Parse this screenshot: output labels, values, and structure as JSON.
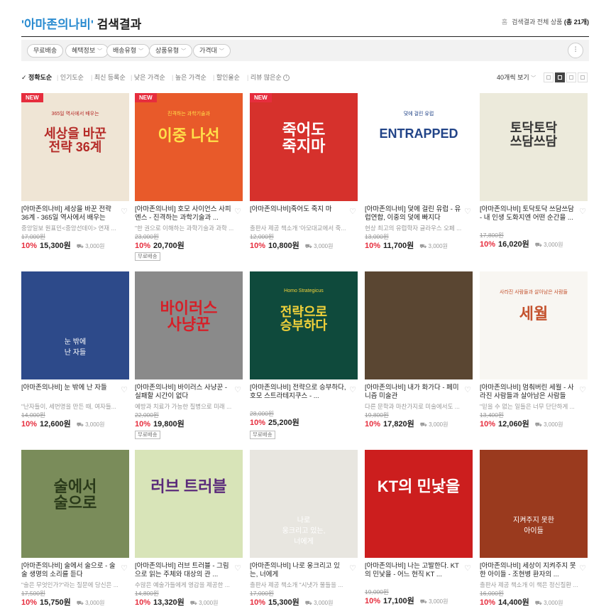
{
  "header": {
    "keyword": "'아마존의나비'",
    "suffix": "검색결과",
    "home": "홈",
    "crumb_pre": "검색결과 전체 상품",
    "crumb_count": "(총 21개)"
  },
  "filters": [
    "무료배송",
    "혜택정보",
    "배송유형",
    "상품유형",
    "가격대"
  ],
  "sorts": [
    "정확도순",
    "인기도순",
    "최신 등록순",
    "낮은 가격순",
    "높은 가격순",
    "할인율순",
    "리뷰 많은순"
  ],
  "view": {
    "per_page": "40개씩 보기"
  },
  "products": [
    {
      "title": "[아마존의나비] 세상을 바꾼 전략 36계 - 365일 역사에서 배우는",
      "desc": "중앙일보 원표민<중앙선데이> 연재 ...",
      "orig": "17,000원",
      "pct": "10%",
      "price": "15,300원",
      "ship": "3,000원",
      "new": true,
      "tag": "",
      "cover": {
        "bg": "#efe5d5",
        "title": "세상을 바꾼\n전략 36계",
        "sub": "365일 역사에서 배우는",
        "color": "#b52b28"
      }
    },
    {
      "title": "[아마존의나비] 호모 사이언스 사피엔스 - 진격하는 과학기술과 ...",
      "desc": "\"한 권으로 이해하는 과학기술과 과학 ...",
      "orig": "23,000원",
      "pct": "10%",
      "price": "20,700원",
      "ship": "",
      "new": true,
      "tag": "무료배송",
      "cover": {
        "bg": "#e85a2a",
        "title": "이중 나선",
        "sub": "진격하는 과학기술과",
        "color": "#ffe04a"
      }
    },
    {
      "title": "[아마존의나비]죽어도 죽지 마",
      "desc": "출판사 제공 책소개 '아모대교에서 죽...",
      "orig": "12,000원",
      "pct": "10%",
      "price": "10,800원",
      "ship": "3,000원",
      "new": true,
      "tag": "",
      "cover": {
        "bg": "#d6312c",
        "title": "죽어도\n죽지마",
        "sub": "",
        "color": "#ffffff"
      }
    },
    {
      "title": "[아마존의나비] 덫에 걸린 유럽 - 유럽연합, 이중의 덫에 빠지다",
      "desc": "현상 최고의 유럽학자 글라우스 오페 ...",
      "orig": "13,000원",
      "pct": "10%",
      "price": "11,700원",
      "ship": "3,000원",
      "new": false,
      "tag": "",
      "cover": {
        "bg": "#ffffff",
        "title": "ENTRAPPED",
        "sub": "덫에 걸린 유럽",
        "color": "#224488"
      }
    },
    {
      "title": "[아마존의나비] 토닥토닥 쓰담쓰담 - 내 인생 도화지엔 어떤 순간을 ...",
      "desc": "",
      "orig": "17,800원",
      "pct": "10%",
      "price": "16,020원",
      "ship": "3,000원",
      "new": false,
      "tag": "",
      "cover": {
        "bg": "#eceadb",
        "title": "토닥토닥\n쓰담쓰담",
        "sub": "",
        "color": "#333333"
      }
    },
    {
      "title": "[아마존의나비] 눈 밖에 난 자들",
      "desc": "\"난자들이, 세번명을 만든 때, 여자들...",
      "orig": "14,000원",
      "pct": "10%",
      "price": "12,600원",
      "ship": "3,000원",
      "new": false,
      "tag": "",
      "cover": {
        "bg": "#2d4a8a",
        "title": "",
        "sub": "눈 밖에\n난 자들",
        "color": "#ffffff"
      }
    },
    {
      "title": "[아마존의나비] 바이러스 사냥꾼 - 실패할 시간이 없다",
      "desc": "예방과 치료가 가능한 질병으로 미래 ...",
      "orig": "22,000원",
      "pct": "10%",
      "price": "19,800원",
      "ship": "",
      "new": false,
      "tag": "무료배송",
      "cover": {
        "bg": "#8a8a8a",
        "title": "바이러스\n사냥꾼",
        "sub": "",
        "color": "#d61f28"
      }
    },
    {
      "title": "[아마존의나비] 전략으로 승부하다, 호모 스트라테지쿠스 - ...",
      "desc": "",
      "orig": "28,000원",
      "pct": "10%",
      "price": "25,200원",
      "ship": "",
      "new": false,
      "tag": "무료배송",
      "cover": {
        "bg": "#0f4a3c",
        "title": "전략으로\n승부하다",
        "sub": "Homo Strategicus",
        "color": "#f2d23a"
      }
    },
    {
      "title": "[아마존의나비] 내가 화가다 - 페미니즘 미술관",
      "desc": "다른 문학과 마찬가지로 미술에서도 ...",
      "orig": "19,800원",
      "pct": "10%",
      "price": "17,820원",
      "ship": "3,000원",
      "new": false,
      "tag": "",
      "cover": {
        "bg": "#5a4632",
        "title": "",
        "sub": "",
        "color": "#ffffff"
      }
    },
    {
      "title": "[아마존의나비] 멈춰버린 세월 - 사라진 사람들과 살아남은 사람들",
      "desc": "\"믿을 수 없는 일들은 너무 단단하게 ...",
      "orig": "13,400원",
      "pct": "10%",
      "price": "12,060원",
      "ship": "3,000원",
      "new": false,
      "tag": "",
      "cover": {
        "bg": "#f8f6f2",
        "title": "세월",
        "sub": "사라진 사람들과 살아남은 사람들",
        "color": "#c4522e"
      }
    },
    {
      "title": "[아마존의나비] 술에서 술으로 - 술술 생명의 소리를 듣다",
      "desc": "\"술은 무엇인가?\"라는 질문에 당신은 ...",
      "orig": "17,500원",
      "pct": "10%",
      "price": "15,750원",
      "ship": "3,000원",
      "new": false,
      "tag": "",
      "cover": {
        "bg": "#7a8c5a",
        "title": "술에서\n술으로",
        "sub": "",
        "color": "#2a3a1a"
      }
    },
    {
      "title": "[아마존의나비] 러브 트러블 - 그림으로 읽는 주체와 대상의 관 ...",
      "desc": "수많은 예술가들에게 영감을 제공한 ...",
      "orig": "14,800원",
      "pct": "10%",
      "price": "13,320원",
      "ship": "3,000원",
      "new": false,
      "tag": "",
      "cover": {
        "bg": "#d8e4b8",
        "title": "러브 트러블",
        "sub": "",
        "color": "#5a2a7a"
      }
    },
    {
      "title": "[아마존의나비] 나로 웅크리고 있는, 너에게",
      "desc": "출판사 제공 책소개 \"시냇가 물들을 ...",
      "orig": "17,000원",
      "pct": "10%",
      "price": "15,300원",
      "ship": "3,000원",
      "new": false,
      "tag": "",
      "cover": {
        "bg": "#e8e6e0",
        "title": "",
        "sub": "나로\n웅크리고 있는,\n너에게",
        "color": "#ffffff"
      }
    },
    {
      "title": "[아마존의나비] 나는 고발한다. KT의 민낯을 - 어느 현직 KT ...",
      "desc": "",
      "orig": "19,000원",
      "pct": "10%",
      "price": "17,100원",
      "ship": "3,000원",
      "new": false,
      "tag": "",
      "cover": {
        "bg": "#cc1e1e",
        "title": "KT의 민낯을",
        "sub": "",
        "color": "#ffffff"
      }
    },
    {
      "title": "[아마존의나비] 세상이 지켜주지 못한 아이들 - 조현병 환자의 ...",
      "desc": "출판사 제공 책소개 이 책은 정신질환 ...",
      "orig": "16,000원",
      "pct": "10%",
      "price": "14,400원",
      "ship": "3,000원",
      "new": false,
      "tag": "",
      "cover": {
        "bg": "#9a3a1e",
        "title": "",
        "sub": "지켜주지 못한\n아이들",
        "color": "#ffffff"
      }
    }
  ]
}
